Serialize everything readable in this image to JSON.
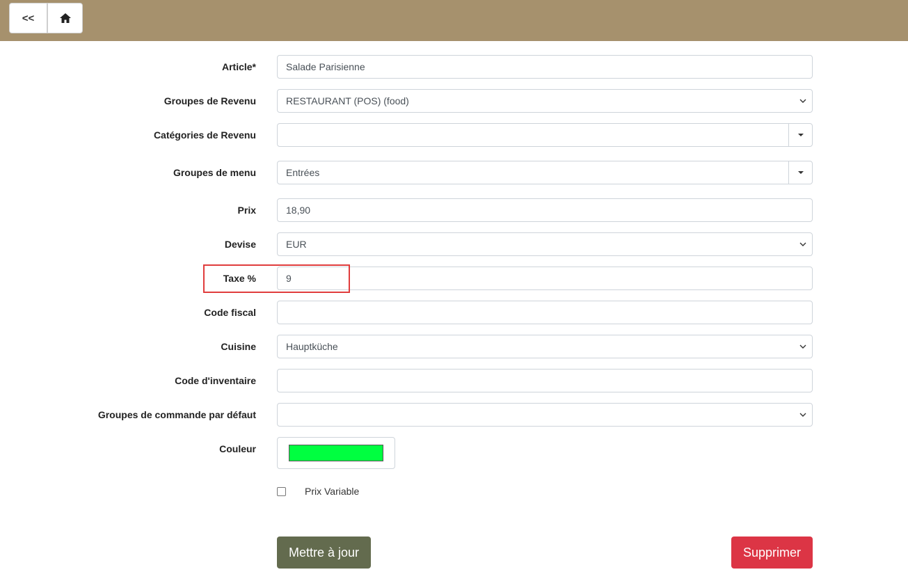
{
  "header": {
    "back_label": "<<",
    "home_icon": "home-icon"
  },
  "form": {
    "article": {
      "label": "Article*",
      "value": "Salade Parisienne"
    },
    "revenue_groups": {
      "label": "Groupes de Revenu",
      "value": "RESTAURANT (POS) (food)"
    },
    "revenue_categories": {
      "label": "Catégories de Revenu",
      "value": ""
    },
    "menu_groups": {
      "label": "Groupes de menu",
      "value": "Entrées"
    },
    "price": {
      "label": "Prix",
      "value": "18,90"
    },
    "currency": {
      "label": "Devise",
      "value": "EUR"
    },
    "tax": {
      "label": "Taxe %",
      "value": "9"
    },
    "fiscal_code": {
      "label": "Code fiscal",
      "value": ""
    },
    "kitchen": {
      "label": "Cuisine",
      "value": "Hauptküche"
    },
    "inventory_code": {
      "label": "Code d'inventaire",
      "value": ""
    },
    "default_order_groups": {
      "label": "Groupes de commande par défaut",
      "value": ""
    },
    "color": {
      "label": "Couleur",
      "value": "#00ff40"
    },
    "variable_price": {
      "label": "Prix Variable",
      "checked": false
    }
  },
  "actions": {
    "update_label": "Mettre à jour",
    "delete_label": "Supprimer"
  },
  "colors": {
    "header_bg": "#a6916d",
    "update_btn": "#636b4e",
    "delete_btn": "#dc3545",
    "highlight": "#e03c3c"
  }
}
